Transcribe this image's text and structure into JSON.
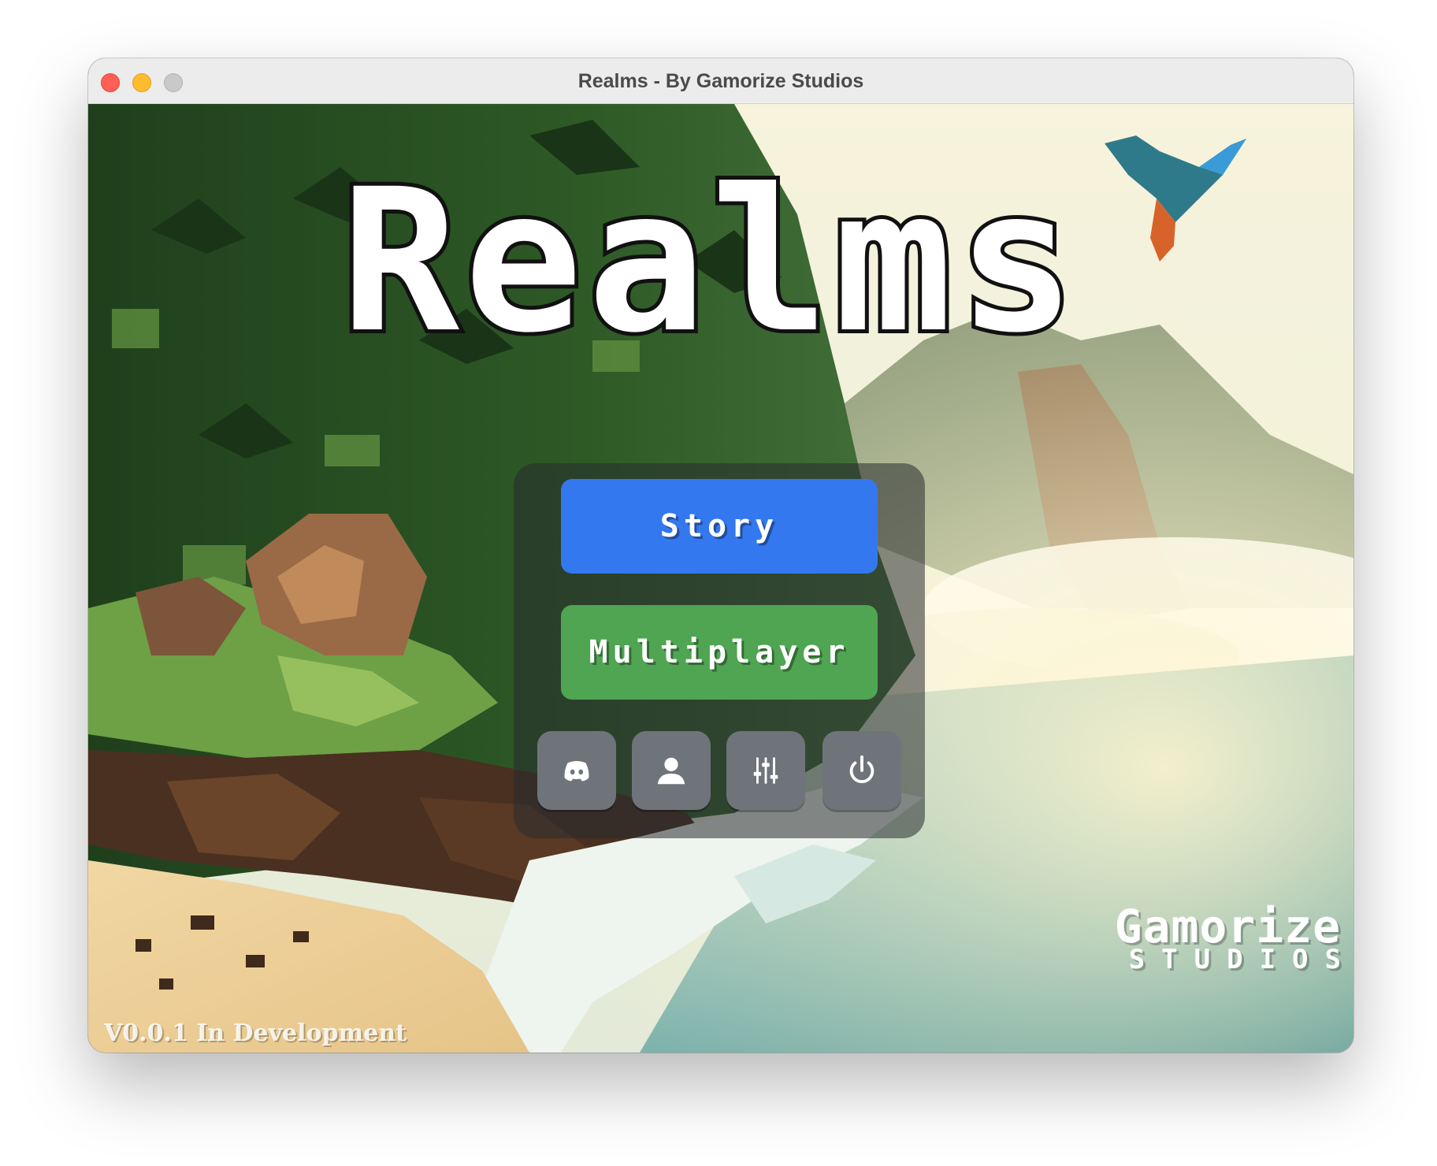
{
  "window": {
    "title": "Realms - By Gamorize Studios"
  },
  "game": {
    "logo_text": "Realms"
  },
  "menu": {
    "story_label": "Story",
    "multiplayer_label": "Multiplayer",
    "icon_buttons": [
      {
        "icon": "discord-icon"
      },
      {
        "icon": "profile-icon"
      },
      {
        "icon": "settings-sliders-icon"
      },
      {
        "icon": "power-icon"
      }
    ]
  },
  "footer": {
    "version": "V0.0.1 In Development",
    "studio_name": "Gamorize",
    "studio_sub": "STUDIOS"
  },
  "colors": {
    "story_button": "#3478f0",
    "multiplayer_button": "#4fa552",
    "icon_button": "#6f747b"
  }
}
